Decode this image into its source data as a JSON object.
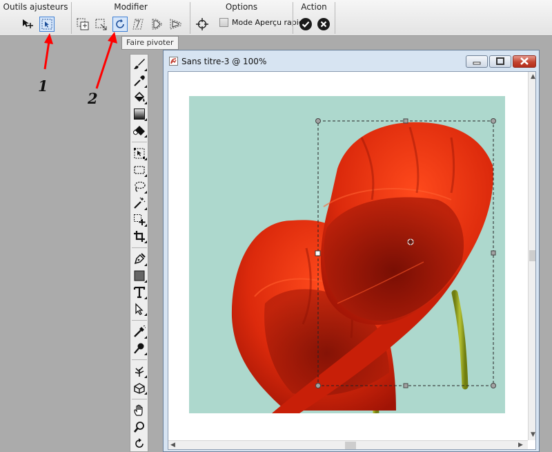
{
  "toolbar": {
    "groups": {
      "adjusters": {
        "title": "Outils ajusteurs"
      },
      "modify": {
        "title": "Modifier"
      },
      "options": {
        "title": "Options",
        "preview_label": "Mode Aperçu rapide"
      },
      "action": {
        "title": "Action"
      }
    },
    "tooltip": "Faire pivoter"
  },
  "annotations": {
    "one": "1",
    "two": "2"
  },
  "document": {
    "title": "Sans titre-3 @ 100%"
  },
  "colors": {
    "canvas_bg": "#add8cd",
    "petal_red": "#d92a0d",
    "petal_dark": "#8c1205",
    "stem": "#9aa81d",
    "annotation_arrow": "#ff0000",
    "active_button": "#3d7fd4"
  },
  "icons": {
    "tools": [
      "brush-icon",
      "dropper-icon",
      "fill-bucket-icon",
      "gradient-icon",
      "eraser-icon",
      "transform-icon",
      "marquee-icon",
      "lasso-icon",
      "magic-wand-icon",
      "selection-add-icon",
      "crop-icon",
      "pen-icon",
      "rectangle-shape-icon",
      "text-icon",
      "direct-select-icon",
      "pin-light-icon",
      "spot-heal-icon",
      "tree-brush-icon",
      "3d-box-icon",
      "hand-icon",
      "zoom-icon",
      "rotate-view-icon"
    ]
  }
}
